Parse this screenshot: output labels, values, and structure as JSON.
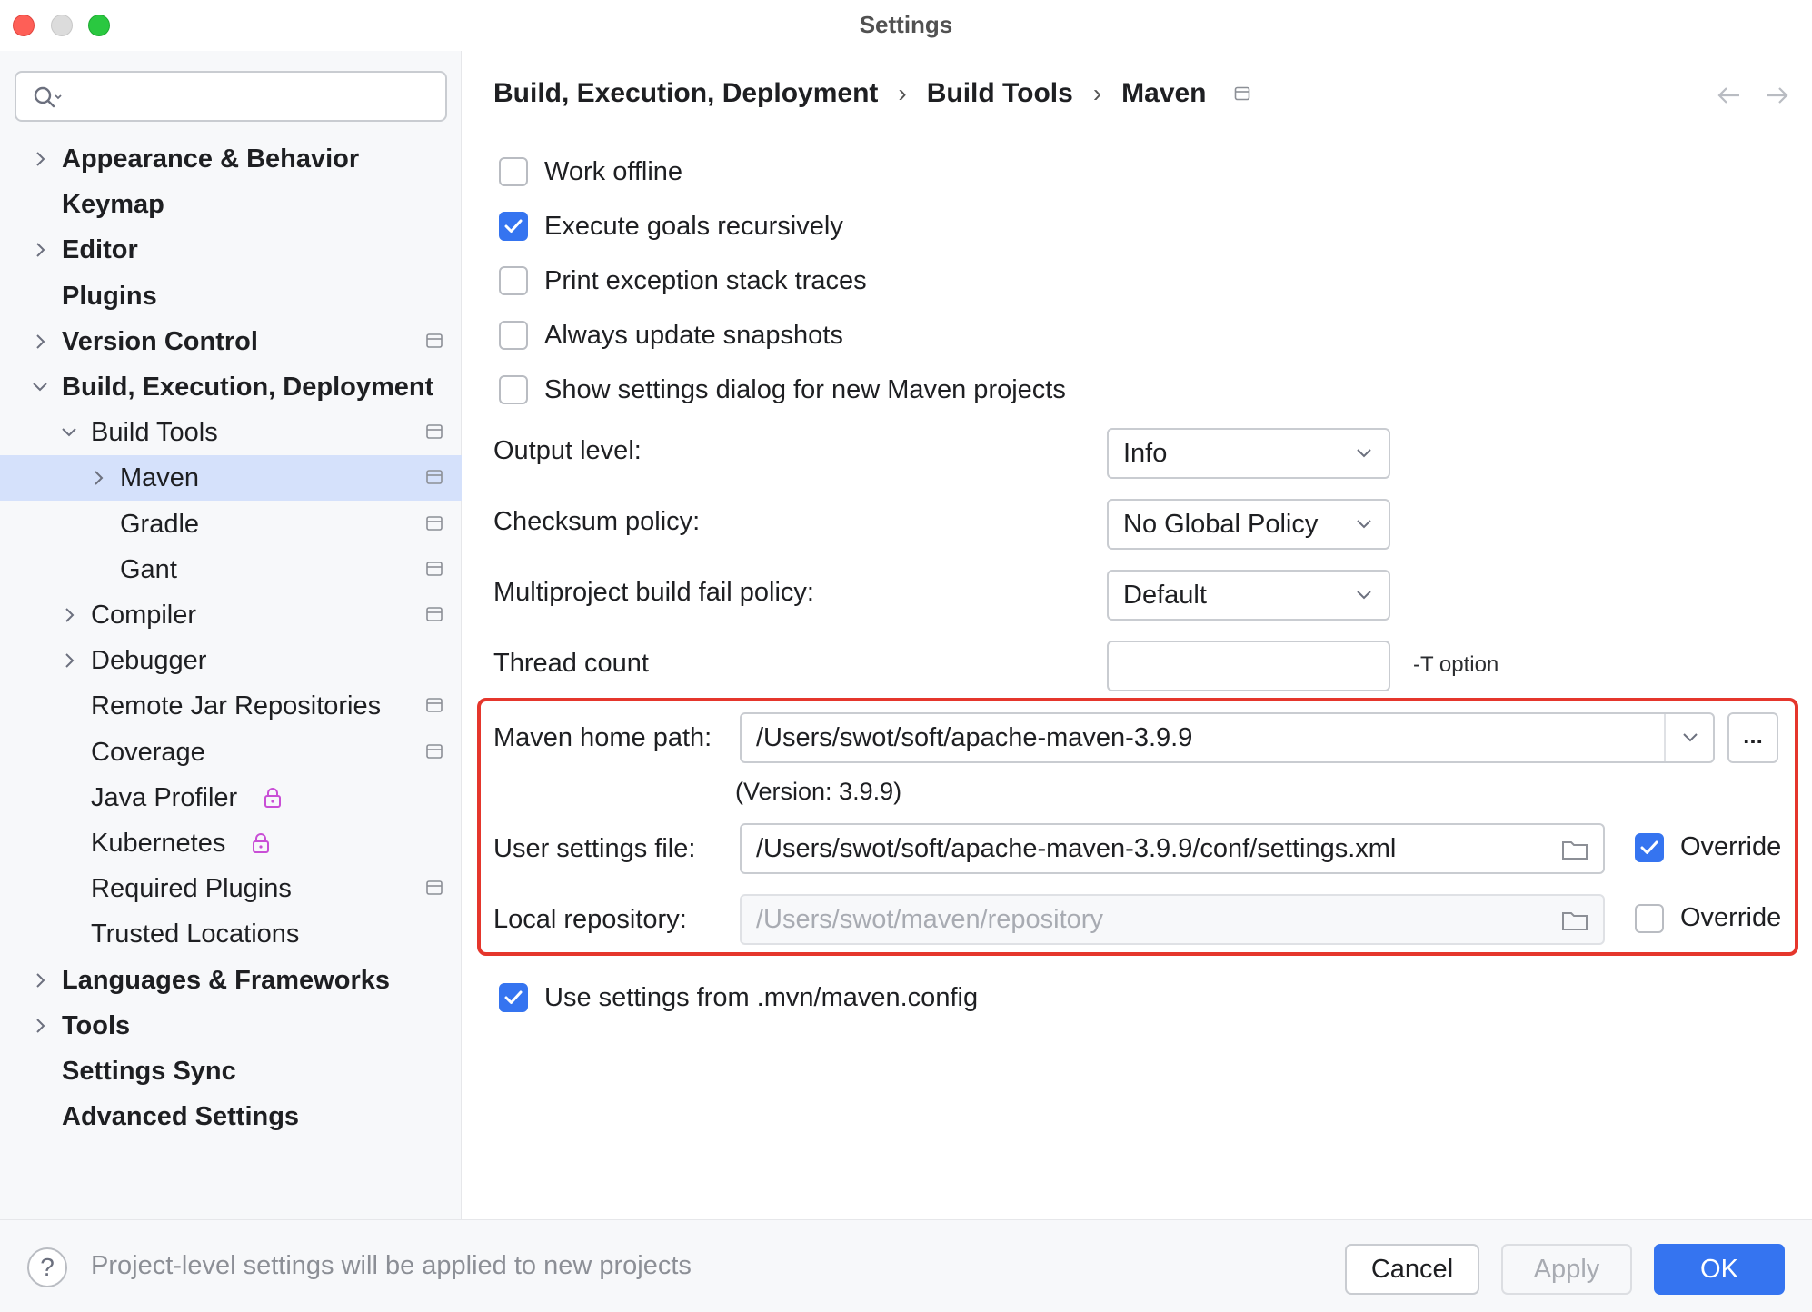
{
  "window": {
    "title": "Settings"
  },
  "sidebar": {
    "search": {
      "placeholder": ""
    },
    "items": [
      {
        "label": "Appearance & Behavior",
        "bold": true,
        "expandable": true
      },
      {
        "label": "Keymap",
        "bold": true
      },
      {
        "label": "Editor",
        "bold": true,
        "expandable": true
      },
      {
        "label": "Plugins",
        "bold": true
      },
      {
        "label": "Version Control",
        "bold": true,
        "expandable": true
      },
      {
        "label": "Build, Execution, Deployment",
        "bold": true,
        "expanded": true
      },
      {
        "label": "Build Tools",
        "expanded": true
      },
      {
        "label": "Maven",
        "selected": true,
        "expandable": true
      },
      {
        "label": "Gradle"
      },
      {
        "label": "Gant"
      },
      {
        "label": "Compiler",
        "expandable": true
      },
      {
        "label": "Debugger",
        "expandable": true
      },
      {
        "label": "Remote Jar Repositories"
      },
      {
        "label": "Coverage"
      },
      {
        "label": "Java Profiler",
        "locked": true
      },
      {
        "label": "Kubernetes",
        "locked": true
      },
      {
        "label": "Required Plugins"
      },
      {
        "label": "Trusted Locations"
      },
      {
        "label": "Languages & Frameworks",
        "bold": true,
        "expandable": true
      },
      {
        "label": "Tools",
        "bold": true,
        "expandable": true
      },
      {
        "label": "Settings Sync",
        "bold": true
      },
      {
        "label": "Advanced Settings",
        "bold": true
      }
    ]
  },
  "breadcrumb": [
    "Build, Execution, Deployment",
    "Build Tools",
    "Maven"
  ],
  "options": {
    "work_offline": {
      "label": "Work offline",
      "checked": false
    },
    "execute_goals": {
      "label": "Execute goals recursively",
      "checked": true
    },
    "print_exception": {
      "label": "Print exception stack traces",
      "checked": false
    },
    "always_update": {
      "label": "Always update snapshots",
      "checked": false
    },
    "show_settings_dialog": {
      "label": "Show settings dialog for new Maven projects",
      "checked": false
    },
    "use_mvn_config": {
      "label": "Use settings from .mvn/maven.config",
      "checked": true
    }
  },
  "form": {
    "output_level": {
      "label": "Output level:",
      "value": "Info"
    },
    "checksum_policy": {
      "label": "Checksum policy:",
      "value": "No Global Policy"
    },
    "multiproject_fail": {
      "label": "Multiproject build fail policy:",
      "value": "Default"
    },
    "thread_count": {
      "label": "Thread count",
      "value": "",
      "hint": "-T option"
    },
    "maven_home": {
      "label": "Maven home path:",
      "value": "/Users/swot/soft/apache-maven-3.9.9",
      "ellipsis": "...",
      "version": "(Version: 3.9.9)"
    },
    "user_settings": {
      "label": "User settings file:",
      "value": "/Users/swot/soft/apache-maven-3.9.9/conf/settings.xml",
      "override_label": "Override",
      "override": true
    },
    "local_repo": {
      "label": "Local repository:",
      "value": "/Users/swot/maven/repository",
      "override_label": "Override",
      "override": false
    }
  },
  "footer": {
    "help": "?",
    "note": "Project-level settings will be applied to new projects",
    "cancel": "Cancel",
    "apply": "Apply",
    "ok": "OK"
  },
  "colors": {
    "accent": "#3574f0",
    "highlight": "#e5362c",
    "selected_bg": "#d5e1fb"
  }
}
